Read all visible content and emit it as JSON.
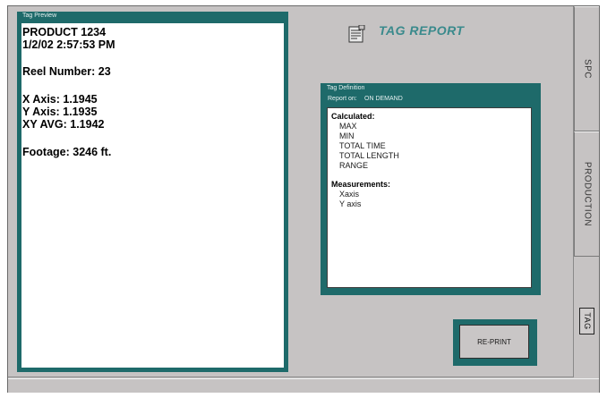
{
  "preview": {
    "title": "Tag Preview",
    "product": "PRODUCT 1234",
    "datetime": "1/2/02 2:57:53 PM",
    "reel": "Reel Number: 23",
    "x_axis": "X Axis: 1.1945",
    "y_axis": "Y Axis: 1.1935",
    "xy_avg": "XY AVG: 1.1942",
    "footage": "Footage: 3246 ft."
  },
  "header": {
    "title": "TAG REPORT",
    "icon": "report-icon",
    "title_color": "#3a8a8c"
  },
  "definition": {
    "title": "Tag Definition",
    "report_on_label": "Report on:",
    "report_on_value": "ON DEMAND",
    "calculated_heading": "Calculated:",
    "calculated_items": [
      "MAX",
      "MIN",
      "TOTAL TIME",
      "TOTAL LENGTH",
      "RANGE"
    ],
    "measurements_heading": "Measurements:",
    "measurement_items": [
      "Xaxis",
      "Y axis"
    ]
  },
  "buttons": {
    "reprint": "RE-PRINT"
  },
  "tabs": {
    "spc": "SPC",
    "production": "PRODUCTION",
    "tag": "TAG"
  },
  "colors": {
    "panel": "#1e6a6a",
    "background": "#c6c3c3"
  }
}
